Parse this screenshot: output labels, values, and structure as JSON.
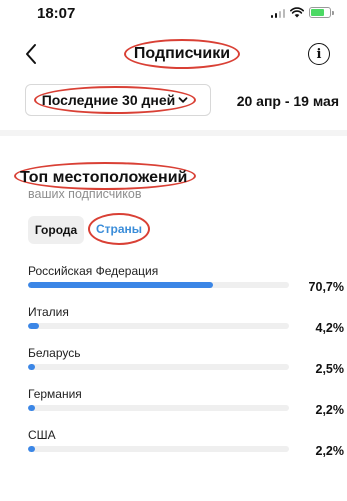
{
  "status": {
    "time": "18:07"
  },
  "nav": {
    "title": "Подписчики"
  },
  "range": {
    "label": "Последние 30 дней",
    "dates": "20 апр - 19 мая"
  },
  "section": {
    "title": "Топ местоположений",
    "subtitle": "ваших подписчиков"
  },
  "tabs": {
    "city": "Города",
    "country": "Страны",
    "selected": "Страны"
  },
  "colors": {
    "accent": "#3b86e6",
    "annotation": "#d94035"
  },
  "locations": [
    {
      "name": "Российская Федерация",
      "percent_text": "70,7%",
      "value": 70.7
    },
    {
      "name": "Италия",
      "percent_text": "4,2%",
      "value": 4.2
    },
    {
      "name": "Беларусь",
      "percent_text": "2,5%",
      "value": 2.5
    },
    {
      "name": "Германия",
      "percent_text": "2,2%",
      "value": 2.2
    },
    {
      "name": "США",
      "percent_text": "2,2%",
      "value": 2.2
    }
  ]
}
